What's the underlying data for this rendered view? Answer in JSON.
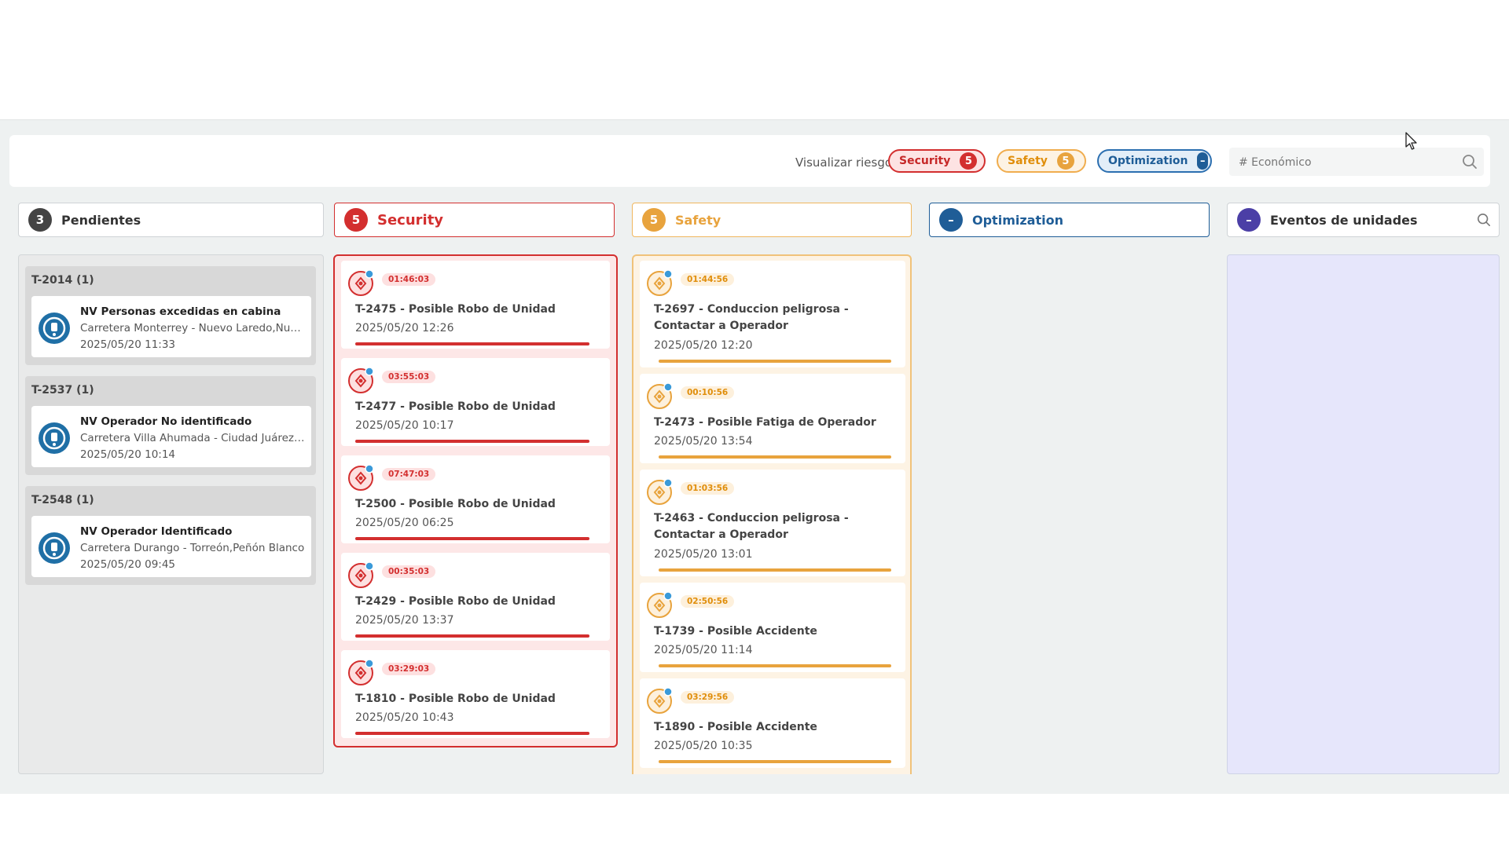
{
  "filter": {
    "label": "Visualizar riesgo :",
    "pills": [
      {
        "label": "Security",
        "count": "5"
      },
      {
        "label": "Safety",
        "count": "5"
      },
      {
        "label": "Optimization",
        "count": "–"
      }
    ],
    "search_placeholder": "# Económico"
  },
  "columns": {
    "pendientes": {
      "title": "Pendientes",
      "count": "3"
    },
    "security": {
      "title": "Security",
      "count": "5"
    },
    "safety": {
      "title": "Safety",
      "count": "5"
    },
    "optimization": {
      "title": "Optimization",
      "count": "–"
    },
    "eventos": {
      "title": "Eventos de unidades",
      "count": "–"
    }
  },
  "pendientes": [
    {
      "group": "T-2014 (1)",
      "title": "NV Personas excedidas en cabina",
      "location": "Carretera Monterrey - Nuevo Laredo,Nuevo Laredo",
      "date": "2025/05/20 11:33"
    },
    {
      "group": "T-2537 (1)",
      "title": "NV Operador No identificado",
      "location": "Carretera Villa Ahumada - Ciudad Juárez,Juárez",
      "date": "2025/05/20 10:14"
    },
    {
      "group": "T-2548 (1)",
      "title": "NV Operador Identificado",
      "location": "Carretera Durango - Torreón,Peñón Blanco",
      "date": "2025/05/20 09:45"
    }
  ],
  "security": [
    {
      "timer": "01:46:03",
      "title": "T-2475 - Posible Robo de Unidad",
      "date": "2025/05/20 12:26"
    },
    {
      "timer": "03:55:03",
      "title": "T-2477 - Posible Robo de Unidad",
      "date": "2025/05/20 10:17"
    },
    {
      "timer": "07:47:03",
      "title": "T-2500 - Posible Robo de Unidad",
      "date": "2025/05/20 06:25"
    },
    {
      "timer": "00:35:03",
      "title": "T-2429 - Posible Robo de Unidad",
      "date": "2025/05/20 13:37"
    },
    {
      "timer": "03:29:03",
      "title": "T-1810 - Posible Robo de Unidad",
      "date": "2025/05/20 10:43"
    }
  ],
  "safety": [
    {
      "timer": "01:44:56",
      "title": "T-2697 - Conduccion peligrosa - Contactar a Operador",
      "date": "2025/05/20 12:20"
    },
    {
      "timer": "00:10:56",
      "title": "T-2473 - Posible Fatiga de Operador",
      "date": "2025/05/20 13:54"
    },
    {
      "timer": "01:03:56",
      "title": "T-2463 - Conduccion peligrosa - Contactar a Operador",
      "date": "2025/05/20 13:01"
    },
    {
      "timer": "02:50:56",
      "title": "T-1739 - Posible Accidente",
      "date": "2025/05/20 11:14"
    },
    {
      "timer": "03:29:56",
      "title": "T-1890 - Posible Accidente",
      "date": "2025/05/20 10:35"
    }
  ],
  "colors": {
    "security": "#d32f2f",
    "safety": "#e8a33d",
    "optimization": "#1f5d97",
    "eventos": "#4b3fa6"
  }
}
